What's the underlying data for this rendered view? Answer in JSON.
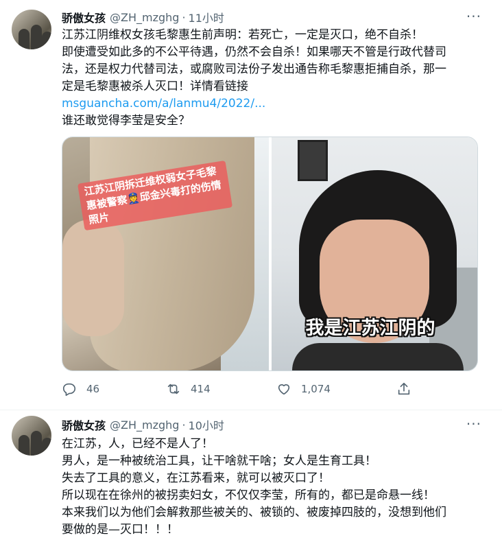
{
  "tweets": [
    {
      "author": {
        "name": "骄傲女孩",
        "handle": "@ZH_mzghg"
      },
      "separator": "·",
      "time": "11小时",
      "more": "···",
      "lines": [
        "江苏江阴维权女孩毛黎惠生前声明：若死亡，一定是灭口，绝不自杀！",
        "即使遭受如此多的不公平待遇，仍然不会自杀！如果哪天不管是行政代替司",
        "法，还是权力代替司法，或腐败司法份子发出通告称毛黎惠拒捕自杀，那一",
        "定是毛黎惠被杀人灭口！详情看链接"
      ],
      "link": "msguancha.com/a/lanmu4/2022/...",
      "last_line": "谁还敢觉得李莹是安全？",
      "media": {
        "left_caption": "江苏江阴拆迁维权弱女子毛黎惠被警察👮邱金兴毒打的伤情照片",
        "right_caption": "我是江苏江阴的"
      },
      "actions": {
        "reply_count": "46",
        "retweet_count": "414",
        "like_count": "1,074"
      }
    },
    {
      "author": {
        "name": "骄傲女孩",
        "handle": "@ZH_mzghg"
      },
      "separator": "·",
      "time": "10小时",
      "more": "···",
      "lines": [
        "在江苏，人，已经不是人了！",
        "男人，是一种被统治工具，让干啥就干啥；女人是生育工具！",
        "失去了工具的意义，在江苏看来，就可以被灭口了！",
        "所以现在在徐州的被拐卖妇女，不仅仅李莹，所有的，都已是命悬一线！",
        "本来我们以为他们会解救那些被关的、被锁的、被废掉四肢的，没想到他们",
        "要做的是—灭口！！！"
      ]
    }
  ],
  "icons": [
    "reply-icon",
    "retweet-icon",
    "like-icon",
    "share-icon",
    "more-icon"
  ],
  "colors": {
    "link": "#1d9bf0",
    "muted": "#536471",
    "text": "#0f1419",
    "border": "#eff3f4"
  }
}
